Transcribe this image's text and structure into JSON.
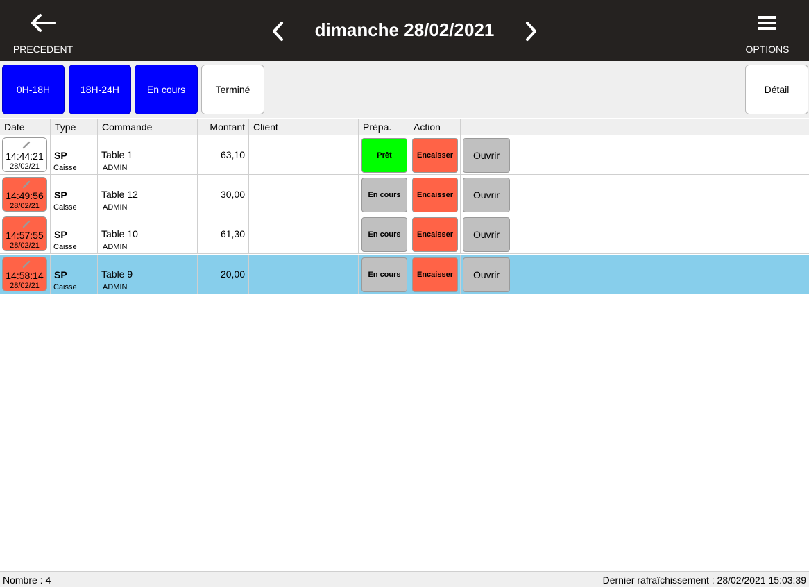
{
  "header": {
    "back_label": "PRECEDENT",
    "options_label": "OPTIONS",
    "day_title": "dimanche 28/02/2021"
  },
  "filters": {
    "f1": "0H-18H",
    "f2": "18H-24H",
    "f3": "En cours",
    "f4": "Terminé",
    "detail": "Détail"
  },
  "columns": {
    "date": "Date",
    "type": "Type",
    "commande": "Commande",
    "montant": "Montant",
    "client": "Client",
    "prepa": "Prépa.",
    "action": "Action"
  },
  "rows": [
    {
      "time": "14:44:21",
      "date": "28/02/21",
      "type": "SP",
      "type_sub": "Caisse",
      "commande": "Table 1",
      "user": "ADMIN",
      "montant": "63,10",
      "client": "",
      "prepa": "Prêt",
      "action": "Encaisser",
      "open": "Ouvrir"
    },
    {
      "time": "14:49:56",
      "date": "28/02/21",
      "type": "SP",
      "type_sub": "Caisse",
      "commande": "Table 12",
      "user": "ADMIN",
      "montant": "30,00",
      "client": "",
      "prepa": "En cours",
      "action": "Encaisser",
      "open": "Ouvrir"
    },
    {
      "time": "14:57:55",
      "date": "28/02/21",
      "type": "SP",
      "type_sub": "Caisse",
      "commande": "Table 10",
      "user": "ADMIN",
      "montant": "61,30",
      "client": "",
      "prepa": "En cours",
      "action": "Encaisser",
      "open": "Ouvrir"
    },
    {
      "time": "14:58:14",
      "date": "28/02/21",
      "type": "SP",
      "type_sub": "Caisse",
      "commande": "Table 9",
      "user": "ADMIN",
      "montant": "20,00",
      "client": "",
      "prepa": "En cours",
      "action": "Encaisser",
      "open": "Ouvrir"
    }
  ],
  "status": {
    "count": "Nombre : 4",
    "refresh": "Dernier rafraîchissement : 28/02/2021 15:03:39"
  },
  "colors": {
    "topbar": "#252220",
    "filter_active": "#0000ff",
    "late": "#ff6347",
    "ready": "#00ff00",
    "selected_row": "#87ceeb"
  },
  "icons": {
    "back": "arrow-left-icon",
    "options": "hamburger-menu-icon",
    "prev_day": "chevron-left-icon",
    "next_day": "chevron-right-icon",
    "edit": "pencil-icon"
  }
}
